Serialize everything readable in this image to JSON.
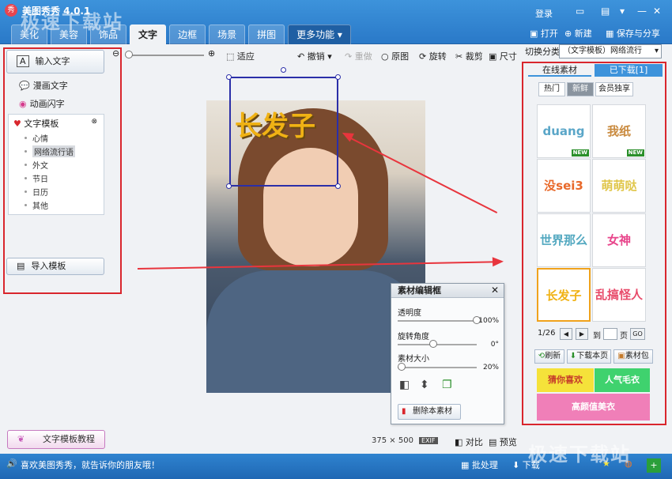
{
  "window": {
    "title": "美图秀秀 4.0.1",
    "watermark_top": "极速下载站",
    "watermark_bottom": "极速下载站",
    "login": "登录"
  },
  "tabs": [
    {
      "label": "美化"
    },
    {
      "label": "美容"
    },
    {
      "label": "饰品"
    },
    {
      "label": "文字"
    },
    {
      "label": "边框"
    },
    {
      "label": "场景"
    },
    {
      "label": "拼图"
    },
    {
      "label": "更多功能 ▾"
    }
  ],
  "top_actions": {
    "open": "打开",
    "new": "新建",
    "save": "保存与分享"
  },
  "toolbar": {
    "fit": "适应",
    "undo": "撤销",
    "redo": "重做",
    "original": "原图",
    "rotate": "旋转",
    "crop": "裁剪",
    "size": "尺寸"
  },
  "left_panel": {
    "input_text": "输入文字",
    "comic_text": "漫画文字",
    "animated_text": "动画闪字",
    "template_header": "文字模板",
    "template_items": [
      "心情",
      "网络流行语",
      "外文",
      "节日",
      "日历",
      "其他"
    ],
    "import_template": "导入模板",
    "tutorial": "文字模板教程"
  },
  "image_info": {
    "width": "375",
    "separator": "×",
    "height": "500",
    "exif": "EXIF",
    "compare": "对比",
    "preview": "预览"
  },
  "sticker": {
    "text": "长发子"
  },
  "editor": {
    "title": "素材编辑框",
    "close": "✕",
    "opacity_label": "透明度",
    "opacity_value": "100%",
    "opacity": 1.0,
    "rotation_label": "旋转角度",
    "rotation_value": "0°",
    "rotation": 0.45,
    "size_label": "素材大小",
    "size_value": "20%",
    "size": 0.05,
    "delete": "删除本素材"
  },
  "right_panel": {
    "category_label": "切换分类",
    "category_value": "（文字模板）网络流行",
    "tabs": [
      "在线素材",
      "已下载[1]"
    ],
    "subtabs": [
      "热门",
      "新鲜",
      "会员独享"
    ],
    "cells": [
      {
        "text": "duang",
        "color": "#5aa6c8",
        "new": "NEW"
      },
      {
        "text": "我纸",
        "color": "#c98a3e",
        "new": "NEW"
      },
      {
        "text": "没sei3",
        "color": "#e8692a",
        "new": ""
      },
      {
        "text": "萌萌哒",
        "color": "#e0c64a",
        "new": ""
      },
      {
        "text": "世界那么大",
        "color": "#52a8c0",
        "new": ""
      },
      {
        "text": "女神",
        "color": "#e8458b",
        "new": ""
      },
      {
        "text": "长发子",
        "color": "#f0b214",
        "new": ""
      },
      {
        "text": "乱搞怪人",
        "color": "#e84b6a",
        "new": ""
      }
    ],
    "page": "1/26",
    "goto": "到",
    "page_suffix": "页",
    "go": "GO",
    "refresh": "刷新",
    "download_page": "下载本页",
    "package": "素材包",
    "banners": [
      "猜你喜欢",
      "人气毛衣",
      "高颜值美衣"
    ]
  },
  "status": {
    "message": "喜欢美图秀秀，就告诉你的朋友哦！",
    "batch": "批处理",
    "download": "下载"
  }
}
